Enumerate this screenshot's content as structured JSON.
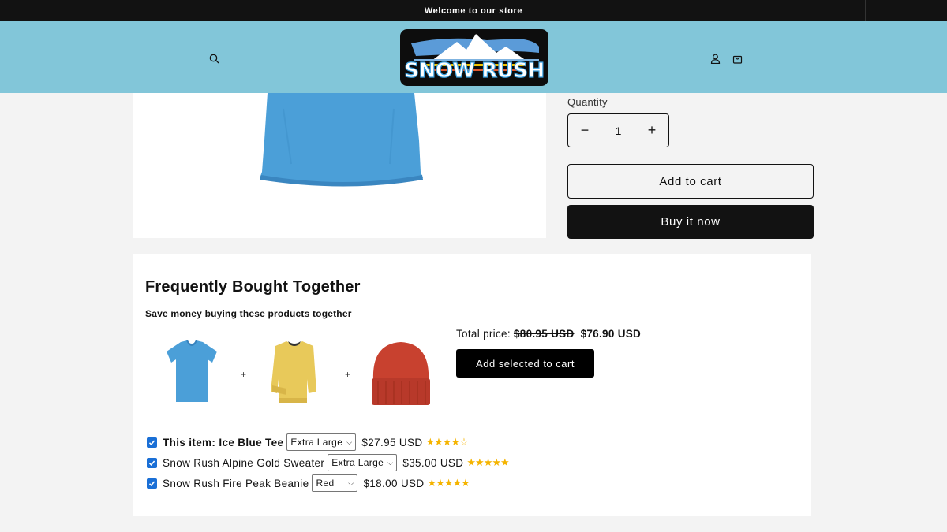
{
  "announcement": "Welcome to our store",
  "header": {
    "logo_text": "SNOW RUSH",
    "icons": [
      "search-icon",
      "account-icon",
      "cart-icon"
    ]
  },
  "product": {
    "quantity_label": "Quantity",
    "quantity_value": "1",
    "decrease_symbol": "−",
    "increase_symbol": "+",
    "add_to_cart": "Add to cart",
    "buy_now": "Buy it now"
  },
  "fbt": {
    "title": "Frequently Bought Together",
    "subtitle": "Save money buying these products together",
    "plus_symbol": "+",
    "total_label": "Total price:",
    "total_old": "$80.95 USD",
    "total_new": "$76.90 USD",
    "add_selected": "Add selected to cart",
    "items": [
      {
        "name": "This item: Ice Blue Tee",
        "variant": "Extra Large",
        "price": "$27.95 USD",
        "rating": 4,
        "checked": true
      },
      {
        "name": "Snow Rush Alpine Gold Sweater",
        "variant": "Extra Large",
        "price": "$35.00 USD",
        "rating": 5,
        "checked": true
      },
      {
        "name": "Snow Rush Fire Peak Beanie",
        "variant": "Red",
        "price": "$18.00 USD",
        "rating": 5,
        "checked": true
      }
    ]
  },
  "colors": {
    "header_bg": "#82c6d9",
    "announcement_bg": "#121212",
    "checkbox": "#1a6fd6",
    "star": "#f5b400"
  }
}
